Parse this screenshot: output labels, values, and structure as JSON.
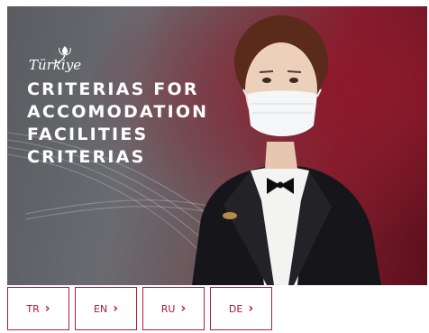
{
  "hero": {
    "brand": "Türkiye",
    "headline_lines": [
      "CRITERIAS FOR",
      "ACCOMODATION",
      "FACILITIES",
      "CRITERIAS"
    ]
  },
  "languages": [
    {
      "code": "TR",
      "icon": "chevron-right-icon"
    },
    {
      "code": "EN",
      "icon": "chevron-right-icon"
    },
    {
      "code": "RU",
      "icon": "chevron-right-icon"
    },
    {
      "code": "DE",
      "icon": "chevron-right-icon"
    }
  ],
  "colors": {
    "accent": "#b71c3a",
    "hero_red": "#7e1f2f",
    "hero_gray": "#5a5c61"
  }
}
